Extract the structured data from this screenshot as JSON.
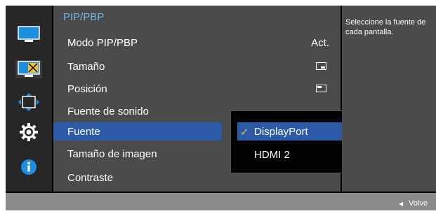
{
  "menu": {
    "title": "PIP/PBP",
    "items": [
      {
        "label": "Modo PIP/PBP",
        "value": "Act."
      },
      {
        "label": "Tamaño",
        "value_icon": "pip-size-icon"
      },
      {
        "label": "Posición",
        "value_icon": "pip-position-icon"
      },
      {
        "label": "Fuente de sonido"
      },
      {
        "label": "Fuente",
        "selected": true
      },
      {
        "label": "Tamaño de imagen"
      },
      {
        "label": "Contraste"
      }
    ]
  },
  "dropdown": {
    "options": [
      {
        "label": "DisplayPort",
        "selected": true,
        "icon": "checkmark-icon"
      },
      {
        "label": "HDMI 2"
      }
    ]
  },
  "sidebar": {
    "icons": [
      "picture-icon",
      "pip-icon",
      "position-arrows-icon",
      "gear-icon",
      "info-icon"
    ]
  },
  "help": {
    "text": "Seleccione la fuente de cada pantalla."
  },
  "footer": {
    "back_label": "Volve",
    "back_icon": "left-triangle-icon"
  },
  "colors": {
    "title": "#6fb4e8",
    "selection": "#2a5aa8",
    "checkmark": "#f2c028",
    "panel": "#4b4b4b",
    "icon_column": "#272727",
    "footer": "#8a8a8a"
  }
}
